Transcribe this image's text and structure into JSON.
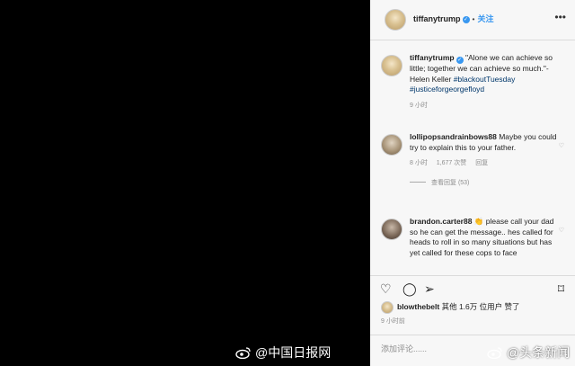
{
  "post": {
    "author": "tiffanytrump",
    "follow_label": "关注",
    "caption_parts": {
      "text": "\"Alone we can achieve so little; together we can achieve so much.\"- Helen Keller",
      "tag1": "#blackoutTuesday",
      "tag2": "#justiceforgeorgefloyd"
    },
    "caption_time": "9 小时"
  },
  "comments": [
    {
      "user": "lollipopsandrainbows88",
      "text": "Maybe you could try to explain this to your father.",
      "time": "8 小时",
      "likes": "1,677 次赞",
      "reply_label": "回复",
      "view_replies": "查看回复 (53)"
    },
    {
      "user": "brandon.carter88",
      "emoji": "👏",
      "text": "please call your dad so he can get the message.. hes called for heads to roll in so many situations but has yet called for these cops to face"
    }
  ],
  "actions": {
    "like_icon": "heart-icon",
    "comment_icon": "comment-icon",
    "share_icon": "share-icon",
    "save_icon": "bookmark-icon"
  },
  "likes_text": {
    "user": "blowthebelt",
    "rest": "其他 1.6万 位用户 赞了"
  },
  "time_ago": "9 小时前",
  "comment_input": {
    "placeholder": "添加评论......"
  },
  "watermarks": {
    "left": "@中国日报网",
    "right": "@头条新闻"
  }
}
